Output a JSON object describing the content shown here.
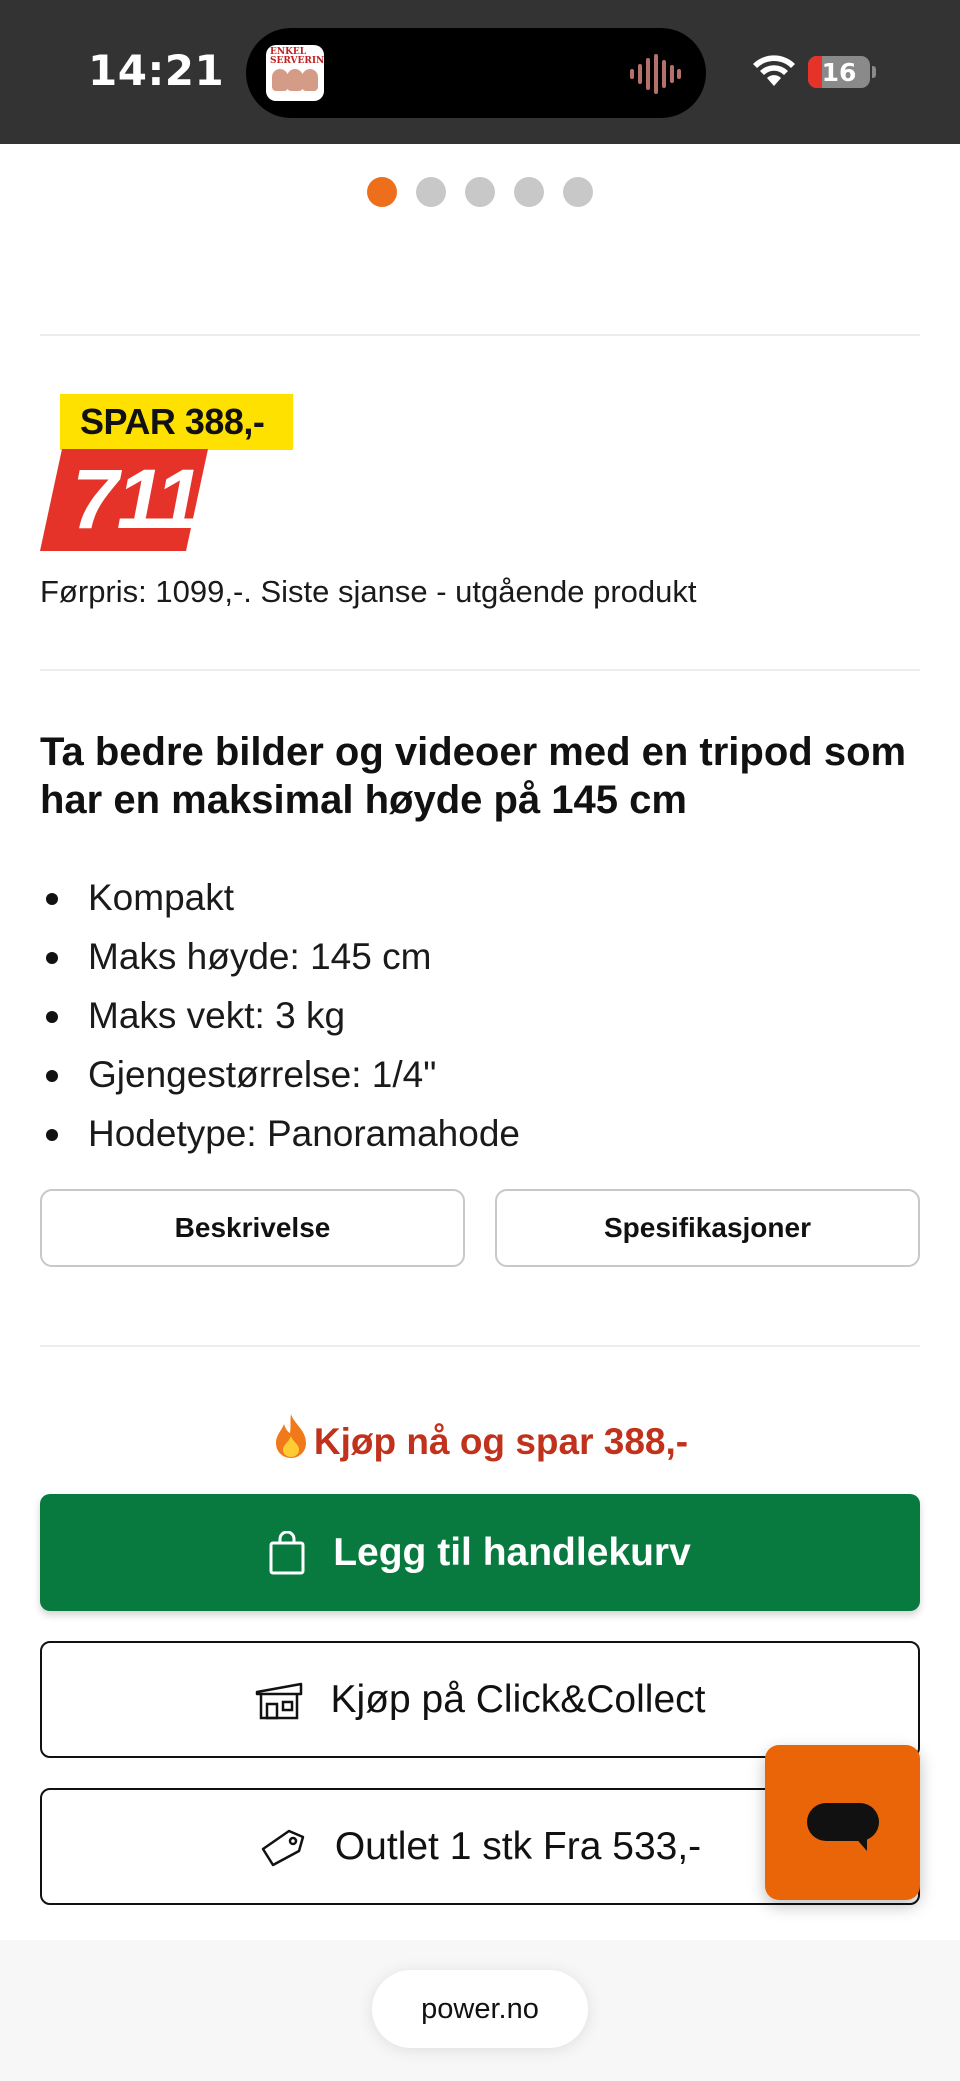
{
  "status_bar": {
    "time": "14:21",
    "battery_level": "16",
    "island_app_icon": "ENKEL SERVERING",
    "island_activity_icon": "waveform-icon",
    "battery_color": "#e5332a"
  },
  "carousel": {
    "total_dots": 5,
    "active_index": 0,
    "active_color": "#ee6f1b"
  },
  "price": {
    "save_label": "SPAR 388,-",
    "current_price": "711",
    "previous_price_text": "Førpris: 1099,-. Siste sjanse - utgående produkt",
    "badge_color": "#ffe100",
    "price_color": "#e5332a"
  },
  "product": {
    "headline": "Ta bedre bilder og videoer med en tripod som har en maksimal høyde på 145 cm",
    "features": [
      "Kompakt",
      "Maks høyde: 145 cm",
      "Maks vekt: 3 kg",
      "Gjengestørrelse: 1/4\"",
      "Hodetype: Panoramahode"
    ],
    "tabs": {
      "description": "Beskrivelse",
      "specifications": "Spesifikasjoner"
    }
  },
  "purchase": {
    "deal_text": "Kjøp nå og spar 388,-",
    "add_to_cart": "Legg til handlekurv",
    "click_collect": "Kjøp på Click&Collect",
    "outlet": "Outlet 1 stk Fra 533,-",
    "primary_color": "#087a3f",
    "icons": {
      "deal": "flame-icon",
      "cart": "shopping-bag-icon",
      "store": "store-icon",
      "outlet": "price-tag-icon",
      "chat": "chat-icon"
    }
  },
  "browser": {
    "url": "power.no"
  }
}
